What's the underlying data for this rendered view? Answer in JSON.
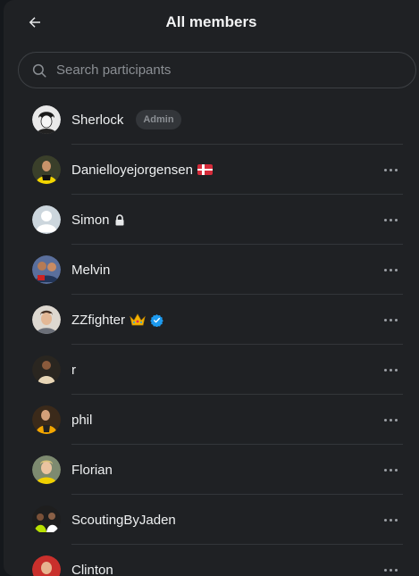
{
  "header": {
    "title": "All members"
  },
  "search": {
    "placeholder": "Search participants"
  },
  "members": [
    {
      "name": "Sherlock",
      "badge": "Admin"
    },
    {
      "name": "Danielloyejorgensen"
    },
    {
      "name": "Simon"
    },
    {
      "name": "Melvin"
    },
    {
      "name": "ZZfighter"
    },
    {
      "name": "r"
    },
    {
      "name": "phil"
    },
    {
      "name": "Florian"
    },
    {
      "name": "ScoutingByJaden"
    },
    {
      "name": "Clinton"
    }
  ],
  "icons": {
    "back": "arrow-left-icon",
    "search": "search-icon",
    "more": "more-horizontal-icon",
    "lock": "lock-icon",
    "crown": "crown-emoji",
    "verified": "verified-badge-icon",
    "flag": "denmark-flag-emoji"
  },
  "colors": {
    "background": "#1f2124",
    "verified": "#1d9bf0",
    "badge_bg": "#33363a"
  }
}
